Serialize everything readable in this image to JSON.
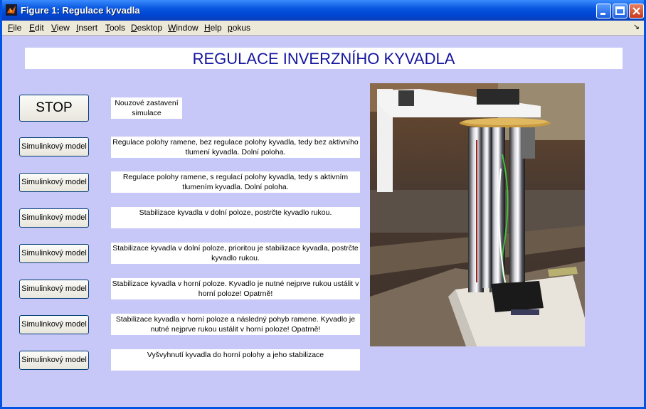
{
  "window": {
    "title": "Figure 1: Regulace kyvadla"
  },
  "menu": [
    {
      "label": "File"
    },
    {
      "label": "Edit"
    },
    {
      "label": "View"
    },
    {
      "label": "Insert"
    },
    {
      "label": "Tools"
    },
    {
      "label": "Desktop"
    },
    {
      "label": "Window"
    },
    {
      "label": "Help"
    },
    {
      "label": "pokus"
    }
  ],
  "header": {
    "title": "REGULACE INVERZNÍHO KYVADLA"
  },
  "stop": {
    "label": "STOP",
    "description": "Nouzové zastavení simulace"
  },
  "models": [
    {
      "button": "Simulinkový model",
      "description": "Regulace polohy ramene, bez regulace polohy kyvadla, tedy bez aktivního tlumení kyvadla. Dolní poloha."
    },
    {
      "button": "Simulinkový model",
      "description": "Regulace polohy ramene, s regulací polohy kyvadla, tedy s aktivním tlumením kyvadla. Dolní poloha."
    },
    {
      "button": "Simulinkový model",
      "description": "Stabilizace kyvadla v dolní poloze, postrčte kyvadlo rukou."
    },
    {
      "button": "Simulinkový model",
      "description": "Stabilizace kyvadla v dolní poloze, prioritou je stabilizace kyvadla, postrčte kyvadlo rukou."
    },
    {
      "button": "Simulinkový model",
      "description": "Stabilizace kyvadla v horní poloze. Kyvadlo je nutné nejprve rukou ustálit v horní poloze! Opatrně!"
    },
    {
      "button": "Simulinkový model",
      "description": "Stabilizace kyvadla v horní poloze a následný pohyb ramene. Kyvadlo je nutné nejprve rukou ustálit v horní poloze! Opatrně!"
    },
    {
      "button": "Simulinkový model",
      "description": "Vyšvyhnutí kyvadla do horní polohy a jeho stabilizace"
    }
  ]
}
